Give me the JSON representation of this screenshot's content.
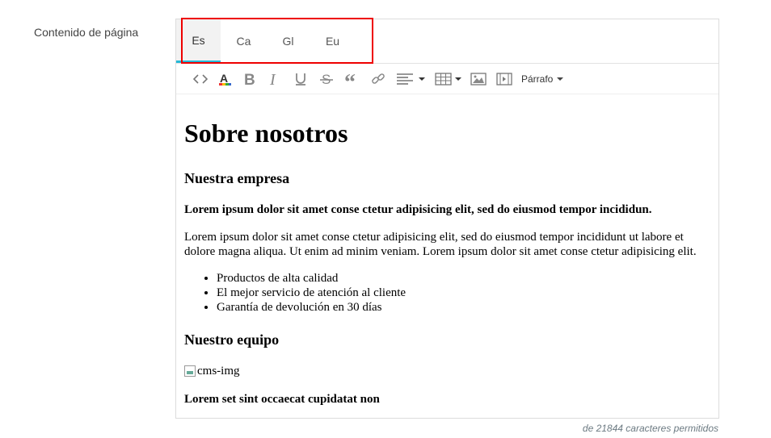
{
  "field": {
    "label": "Contenido de página"
  },
  "languages": {
    "tabs": [
      {
        "label": "Es",
        "active": true
      },
      {
        "label": "Ca",
        "active": false
      },
      {
        "label": "Gl",
        "active": false
      },
      {
        "label": "Eu",
        "active": false
      }
    ],
    "highlight_color": "#ee0000",
    "accent_color": "#25b9d7"
  },
  "toolbar": {
    "buttons": [
      "code-icon",
      "text-color-icon",
      "bold-icon",
      "italic-icon",
      "underline-icon",
      "strikethrough-icon",
      "blockquote-icon",
      "link-icon",
      "align-icon",
      "table-icon",
      "image-icon",
      "media-icon"
    ],
    "format_label": "Párrafo"
  },
  "content": {
    "h1": "Sobre nosotros",
    "h2_company": "Nuestra empresa",
    "lead": "Lorem ipsum dolor sit amet conse ctetur adipisicing elit, sed do eiusmod tempor incididun.",
    "paragraph": "Lorem ipsum dolor sit amet conse ctetur adipisicing elit, sed do eiusmod tempor incididunt ut labore et dolore magna aliqua. Ut enim ad minim veniam. Lorem ipsum dolor sit amet conse ctetur adipisicing elit.",
    "list": [
      "Productos de alta calidad",
      "El mejor servicio de atención al cliente",
      "Garantía de devolución en 30 días"
    ],
    "h2_team": "Nuestro equipo",
    "image_alt": "cms-img",
    "last_bold": "Lorem set sint occaecat cupidatat non"
  },
  "footer": {
    "char_count": "de 21844 caracteres permitidos"
  }
}
